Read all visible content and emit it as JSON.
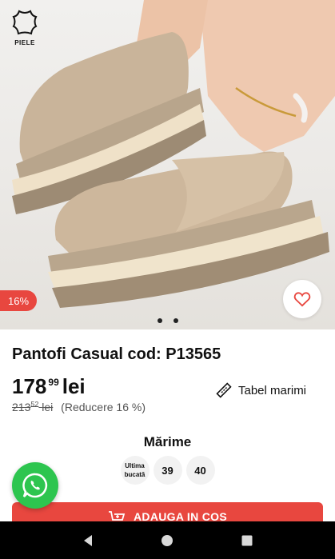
{
  "hero": {
    "leather_badge": {
      "icon": "leather-hide-icon",
      "label": "PIELE"
    },
    "discount_tag": "16%",
    "favorite_icon": "heart-outline-icon",
    "carousel_dots": 2
  },
  "product": {
    "title": "Pantofi Casual cod: P13565",
    "price_integer": "178",
    "price_decimal": "99",
    "currency": "lei",
    "old_price_integer": "213",
    "old_price_decimal": "52",
    "old_currency": "lei",
    "reduction": "(Reducere 16 %)",
    "size_chart_label": "Tabel marimi"
  },
  "sizes": {
    "title": "Mărime",
    "options": [
      {
        "line1": "Ultima",
        "line2": "bucată"
      },
      {
        "label": "39"
      },
      {
        "label": "40"
      }
    ]
  },
  "cart_button": {
    "label": "ADAUGA IN COS",
    "icon": "cart-add-icon"
  },
  "colors": {
    "accent": "#e8473f",
    "whatsapp": "#2dc54f",
    "product": "#c9b49a"
  }
}
